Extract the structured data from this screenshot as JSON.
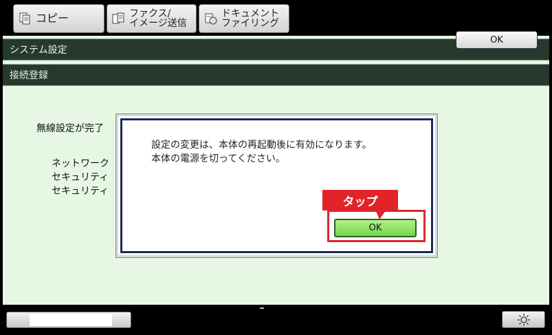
{
  "tabs": [
    {
      "label": "コピー",
      "icon": "copy-icon"
    },
    {
      "label": "ファクス/\nイメージ送信",
      "icon": "fax-icon"
    },
    {
      "label": "ドキュメント\nファイリング",
      "icon": "document-filing-icon"
    }
  ],
  "header": {
    "title": "システム設定",
    "subtitle": "接続登録",
    "ok_label": "OK"
  },
  "background": {
    "status_line": "無線設定が完了",
    "info_lines": [
      "ネットワーク",
      "セキュリティ",
      "セキュリティ"
    ]
  },
  "dialog": {
    "message_lines": [
      "設定の変更は、本体の再起動後に有効になります。",
      "本体の電源を切ってください。"
    ],
    "ok_label": "OK"
  },
  "annotation": {
    "label": "タップ",
    "color": "#e0242a"
  },
  "colors": {
    "header_bar": "#26392d",
    "screen_bg": "#e6f8e4",
    "dialog_border": "#1a2a57",
    "ok_green": "#7edc57"
  }
}
